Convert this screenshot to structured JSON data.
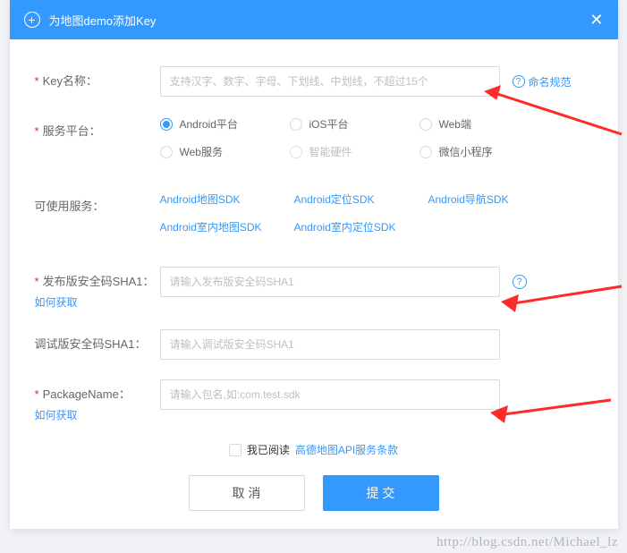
{
  "header": {
    "title": "为地图demo添加Key"
  },
  "form": {
    "keyName": {
      "label": "Key名称：",
      "placeholder": "支持汉字、数字、字母、下划线、中划线，不超过15个",
      "helpLink": "命名规范"
    },
    "platform": {
      "label": "服务平台：",
      "options": [
        {
          "label": "Android平台",
          "checked": true
        },
        {
          "label": "iOS平台",
          "checked": false
        },
        {
          "label": "Web端",
          "checked": false
        },
        {
          "label": "Web服务",
          "checked": false
        },
        {
          "label": "智能硬件",
          "checked": false,
          "disabled": true
        },
        {
          "label": "微信小程序",
          "checked": false
        }
      ]
    },
    "services": {
      "label": "可使用服务：",
      "items": [
        "Android地图SDK",
        "Android定位SDK",
        "Android导航SDK",
        "Android室内地图SDK",
        "Android室内定位SDK"
      ]
    },
    "releaseSha1": {
      "label": "发布版安全码SHA1：",
      "placeholder": "请输入发布版安全码SHA1",
      "subLink": "如何获取"
    },
    "debugSha1": {
      "label": "调试版安全码SHA1：",
      "placeholder": "请输入调试版安全码SHA1"
    },
    "packageName": {
      "label": "PackageName：",
      "placeholder": "请输入包名,如:com.test.sdk",
      "subLink": "如何获取"
    }
  },
  "terms": {
    "prefix": "我已阅读",
    "link": "高德地图API服务条款"
  },
  "buttons": {
    "cancel": "取 消",
    "submit": "提 交"
  },
  "watermark": "http://blog.csdn.net/Michael_lz"
}
